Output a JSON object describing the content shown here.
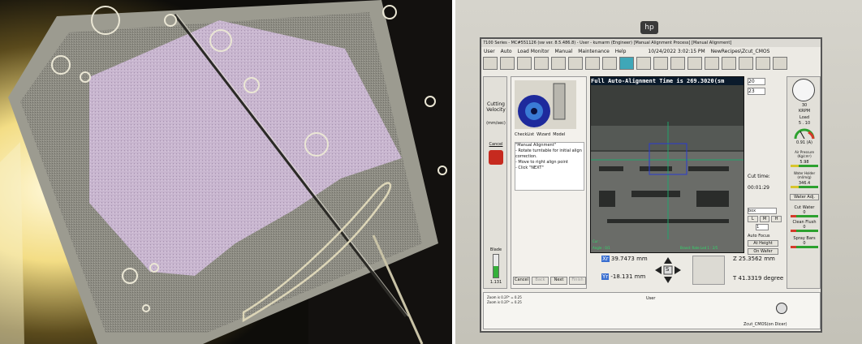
{
  "window": {
    "title": "7100 Series - MC#551126 (sw ver. 8.5.486.8) - User - kumarm (Engineer) [Manual Alignment Process] [Manual Alignment]",
    "menu": [
      "User",
      "Auto",
      "Load Monitor",
      "Manual",
      "Maintenance",
      "Help"
    ],
    "datetime": "10/24/2022 3:02:15 PM",
    "recipe": "NewRecipes\\Zcut_CMOS"
  },
  "monitor": {
    "brand": "hp"
  },
  "left_panel": {
    "cutting_velocity_label": "Cutting Velocity",
    "velocity_unit": "(mm/sec)",
    "cancel_label": "Cancel",
    "blade_label": "Blade",
    "blade_value": "1.131",
    "blade_exp": "Exp : 11 mm"
  },
  "wizard": {
    "tabs": [
      "CheckList",
      "Wizard",
      "Model"
    ],
    "text": "\"Manual Alignment\"\n- Rotate turntable for initial align correction.\n- Move to right align point\n- Click \"NEXT\"",
    "buttons": [
      "Cancel",
      "Back",
      "Next",
      "Finish"
    ],
    "zoom_lines": [
      "Zoom is 0.2F* = 0.25",
      "Zoom is 0.2F* = 0.25"
    ]
  },
  "camera": {
    "banner": "Full Auto-Alignment Time is 269.3020(sm",
    "status_bottom": "Angle : 0/1",
    "status_right": "Brand: Rate Led 1 : 2/5",
    "cursor": "Cur :"
  },
  "spinners": {
    "top": "20",
    "second": "23"
  },
  "cut_time": {
    "label": "Cut time:",
    "value": "00:01:29"
  },
  "index": {
    "select": "box",
    "l": "L",
    "m": "M",
    "h": "H",
    "value": "1"
  },
  "autofocus": {
    "label": "Auto Focus",
    "at_height": "At Height",
    "on_wafer": "On Wafer"
  },
  "coords": {
    "xr_label": "Xr",
    "xr_value": "39.7473",
    "xr_unit": "mm",
    "yr_label": "Yr",
    "yr_value": "-18.131",
    "yr_unit": "mm",
    "z_label": "Z",
    "z_value": "25.3562",
    "z_unit": "mm",
    "t_label": "T",
    "t_value": "41.3319",
    "t_unit": "degree",
    "s_label": "S"
  },
  "right_gauges": {
    "krpm_value": "30",
    "krpm_label": "KRPM",
    "load_label": "Load",
    "load_scale": "5 . 10",
    "amps": "0.91 (A)",
    "air_pressure": "Air Pressure (Kg/cm²)",
    "air_value": "5.98",
    "water_holder": "Water Holder (ml/m/g)",
    "water_value": "346.4",
    "water_adj": "Water Adj.",
    "cut_water": "Cut Water",
    "cut_water_value": "0",
    "clean_flush": "Clean Flush",
    "clean_value": "0",
    "spray_bars": "Spray Bars",
    "spray_value": "0"
  },
  "footer": {
    "user_label": "User",
    "recipe_footer": "Zcut_CMOS(on Dicer)"
  }
}
